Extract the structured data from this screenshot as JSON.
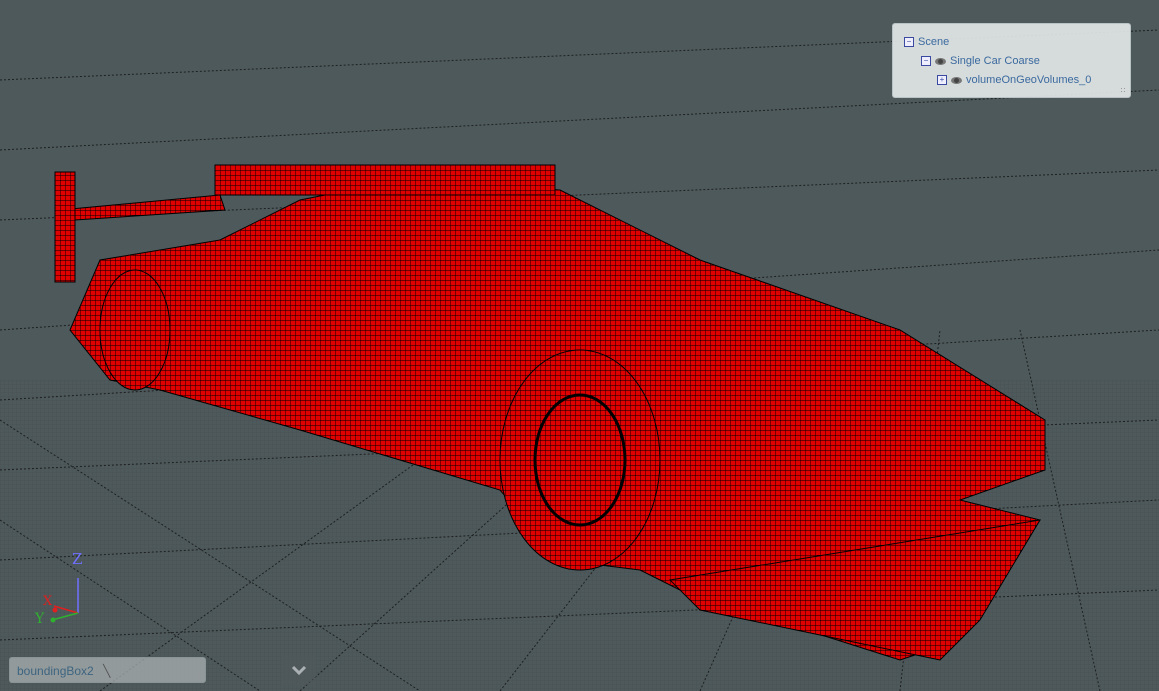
{
  "scene_tree": {
    "items": [
      {
        "label": "Scene",
        "toggle": "−",
        "level": 0,
        "visible_icon": false
      },
      {
        "label": "Single Car Coarse",
        "toggle": "−",
        "level": 1,
        "visible_icon": true
      },
      {
        "label": "volumeOnGeoVolumes_0",
        "toggle": "+",
        "level": 2,
        "visible_icon": true
      }
    ]
  },
  "axes": {
    "x": "X",
    "y": "Y",
    "z": "Z"
  },
  "bottom_bar": {
    "selection_label": "boundingBox2",
    "collapse_icon": "chevron-down-icon"
  },
  "colors": {
    "background": "#4e595b",
    "mesh": "#e00000",
    "x_axis": "#e02020",
    "y_axis": "#30b030",
    "z_axis": "#7070ff"
  }
}
